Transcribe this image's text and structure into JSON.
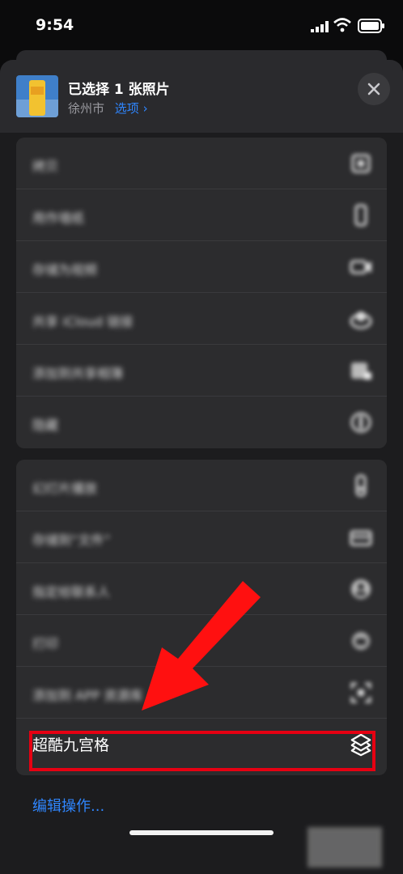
{
  "status_bar": {
    "time": "9:54"
  },
  "header": {
    "title": "已选择 1 张照片",
    "location": "徐州市",
    "options_link": "选项 ›"
  },
  "actions_group_1": [
    {
      "label": "拷贝",
      "icon": "copy-icon"
    },
    {
      "label": "用作墙纸",
      "icon": "phone-icon"
    },
    {
      "label": "存储为视频",
      "icon": "video-icon"
    },
    {
      "label": "共享 iCloud 链接",
      "icon": "cloud-icon"
    },
    {
      "label": "添加到共享相簿",
      "icon": "shared-album-icon"
    },
    {
      "label": "隐藏",
      "icon": "hide-icon"
    }
  ],
  "actions_group_2": [
    {
      "label": "幻灯片播放",
      "icon": "slideshow-icon"
    },
    {
      "label": "存储到“文件”",
      "icon": "folder-icon"
    },
    {
      "label": "指定给联系人",
      "icon": "contact-icon"
    },
    {
      "label": "打印",
      "icon": "printer-icon"
    },
    {
      "label": "添加到 APP 资源库",
      "icon": "scan-icon"
    },
    {
      "label": "超酷九宫格",
      "icon": "shortcuts-layers-icon"
    }
  ],
  "footer": {
    "edit_actions": "编辑操作..."
  },
  "colors": {
    "accent": "#2f86ff",
    "highlight": "#e60012",
    "arrow": "#ff0000"
  }
}
